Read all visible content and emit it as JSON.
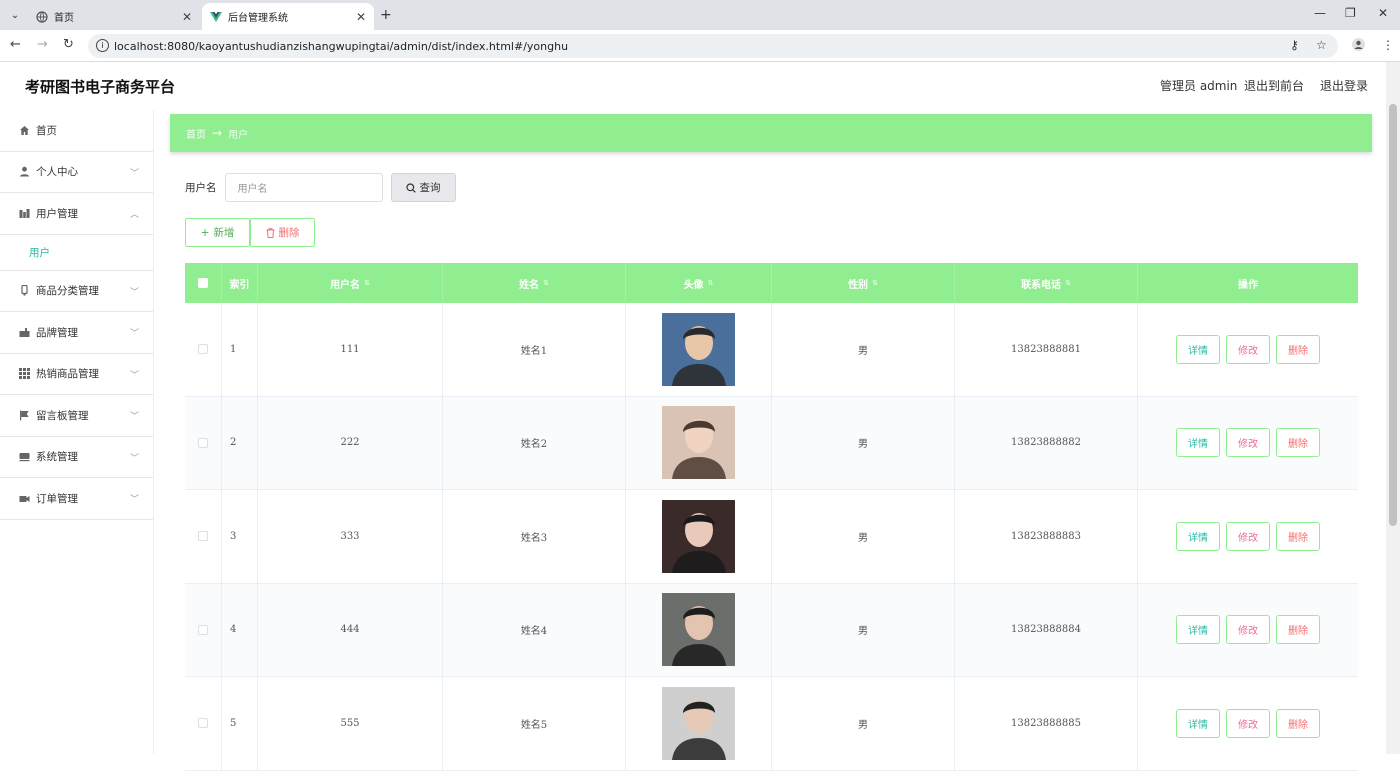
{
  "browser": {
    "tabs": [
      {
        "title": "首页",
        "close": "✕"
      },
      {
        "title": "后台管理系统",
        "close": "✕"
      }
    ],
    "new_tab": "+",
    "url": "localhost:8080/kaoyantushudianzishangwupingtai/admin/dist/index.html#/yonghu"
  },
  "header": {
    "title": "考研图书电子商务平台",
    "admin_label": "管理员 admin",
    "to_front": "退出到前台",
    "logout": "退出登录"
  },
  "sidebar": {
    "items": [
      {
        "label": "首页",
        "icon": "home-icon"
      },
      {
        "label": "个人中心",
        "icon": "user-icon"
      },
      {
        "label": "用户管理",
        "icon": "users-icon",
        "expanded": true,
        "children": [
          {
            "label": "用户"
          }
        ]
      },
      {
        "label": "商品分类管理",
        "icon": "category-icon"
      },
      {
        "label": "品牌管理",
        "icon": "brand-icon"
      },
      {
        "label": "热销商品管理",
        "icon": "grid-icon"
      },
      {
        "label": "留言板管理",
        "icon": "flag-icon"
      },
      {
        "label": "系统管理",
        "icon": "system-icon"
      },
      {
        "label": "订单管理",
        "icon": "order-icon"
      }
    ]
  },
  "breadcrumb": {
    "home": "首页",
    "arrow": "→",
    "current": "用户"
  },
  "search": {
    "label": "用户名",
    "placeholder": "用户名",
    "button": "查询"
  },
  "actions": {
    "add": "新增",
    "delete": "删除"
  },
  "table": {
    "headers": {
      "index": "索引",
      "username": "用户名",
      "name": "姓名",
      "avatar": "头像",
      "gender": "性别",
      "phone": "联系电话",
      "ops": "操作"
    },
    "rows": [
      {
        "index": "1",
        "username": "111",
        "name": "姓名1",
        "gender": "男",
        "phone": "13823888881"
      },
      {
        "index": "2",
        "username": "222",
        "name": "姓名2",
        "gender": "男",
        "phone": "13823888882"
      },
      {
        "index": "3",
        "username": "333",
        "name": "姓名3",
        "gender": "男",
        "phone": "13823888883"
      },
      {
        "index": "4",
        "username": "444",
        "name": "姓名4",
        "gender": "男",
        "phone": "13823888884"
      },
      {
        "index": "5",
        "username": "555",
        "name": "姓名5",
        "gender": "男",
        "phone": "13823888885"
      }
    ],
    "row_ops": {
      "detail": "详情",
      "edit": "修改",
      "remove": "删除"
    }
  },
  "colors": {
    "accent": "#90ee90",
    "teal": "#2bb7a3",
    "danger": "#f56c6c"
  }
}
